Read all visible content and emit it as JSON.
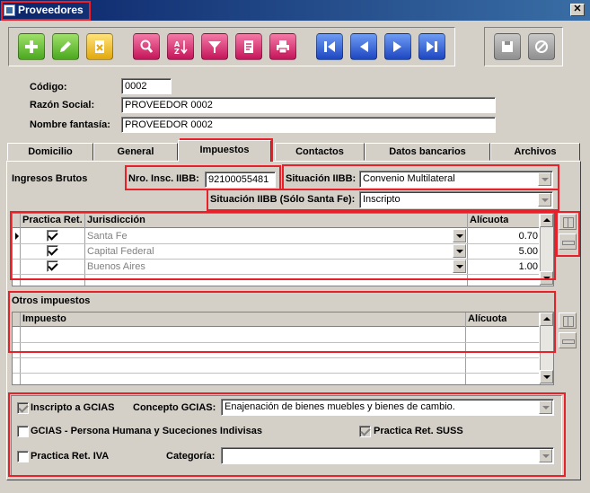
{
  "window": {
    "title": "Proveedores",
    "close_glyph": "✕"
  },
  "form": {
    "codigo_label": "Código:",
    "codigo_value": "0002",
    "razon_label": "Razón Social:",
    "razon_value": "PROVEEDOR 0002",
    "fantasia_label": "Nombre fantasía:",
    "fantasia_value": "PROVEEDOR 0002"
  },
  "tabs": [
    "Domicilio",
    "General",
    "Impuestos",
    "Contactos",
    "Datos bancarios",
    "Archivos"
  ],
  "impuestos": {
    "ib_label": "Ingresos Brutos",
    "nro_label": "Nro. Insc. IIBB:",
    "nro_value": "92100055481",
    "sit_label": "Situación IIBB:",
    "sit_value": "Convenio Multilateral",
    "sit_sf_label": "Situación IIBB (Sólo Santa Fe):",
    "sit_sf_value": "Inscripto",
    "grid1": {
      "headers": [
        "Practica Ret.",
        "Jurisdicción",
        "Alícuota"
      ],
      "rows": [
        {
          "checked": true,
          "jurisdiccion": "Santa Fe",
          "alicuota": "0.70"
        },
        {
          "checked": true,
          "jurisdiccion": "Capital Federal",
          "alicuota": "5.00"
        },
        {
          "checked": true,
          "jurisdiccion": "Buenos Aires",
          "alicuota": "1.00"
        }
      ]
    },
    "otros_label": "Otros impuestos",
    "grid2": {
      "headers": [
        "Impuesto",
        "Alícuota"
      ]
    },
    "gcias_inscripto_label": "Inscripto a GCIAS",
    "concepto_label": "Concepto GCIAS:",
    "concepto_value": "Enajenación de bienes muebles y bienes de cambio.",
    "gcias_persona_label": "GCIAS - Persona Humana y Suceciones Indivisas",
    "suss_label": "Practica Ret. SUSS",
    "iva_label": "Practica Ret. IVA",
    "categoria_label": "Categoría:",
    "categoria_value": ""
  },
  "colors": {
    "highlight": "#e8202a",
    "titlebar": "#0a246a"
  }
}
